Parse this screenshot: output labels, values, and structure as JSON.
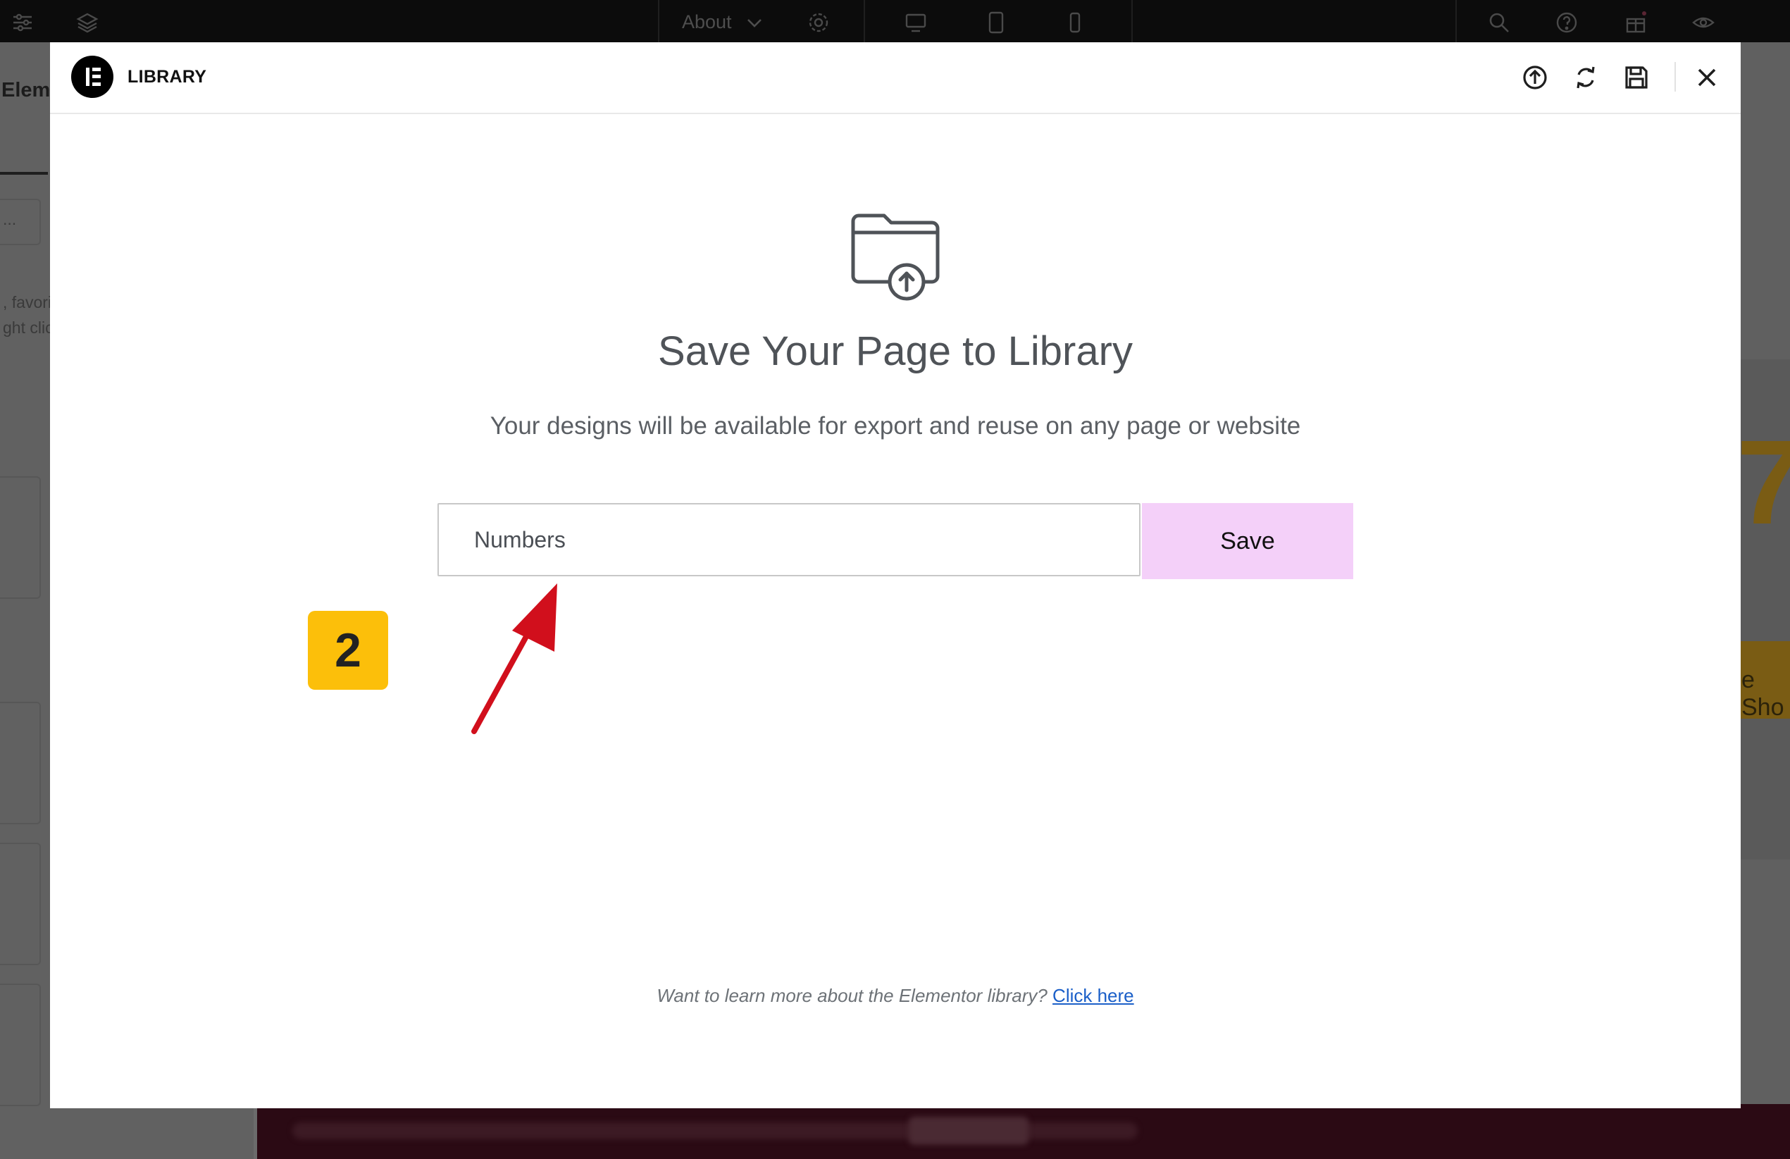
{
  "editor": {
    "topbar": {
      "page_label": "About"
    },
    "left_panel": {
      "title": "Elem",
      "snippet_1": "...",
      "snippet_2": ", favori",
      "snippet_3": "ght clic"
    },
    "right_peek": {
      "button_text": "e Sho",
      "big_glyph": "7"
    }
  },
  "modal": {
    "header": {
      "title": "LIBRARY",
      "icons": [
        "upload-icon",
        "sync-icon",
        "save-icon",
        "close-icon"
      ]
    },
    "body": {
      "title": "Save Your Page to Library",
      "subtitle": "Your designs will be available for export and reuse on any page or website",
      "input_value": "Numbers",
      "save_label": "Save",
      "footer_text": "Want to learn more about the Elementor library?",
      "footer_link": "Click here"
    }
  },
  "annotation": {
    "step_number": "2"
  },
  "colors": {
    "save_button_bg": "#f4d0f9",
    "badge_bg": "#fcbf0a",
    "arrow": "#d10f1c",
    "link": "#1b5fc8"
  }
}
